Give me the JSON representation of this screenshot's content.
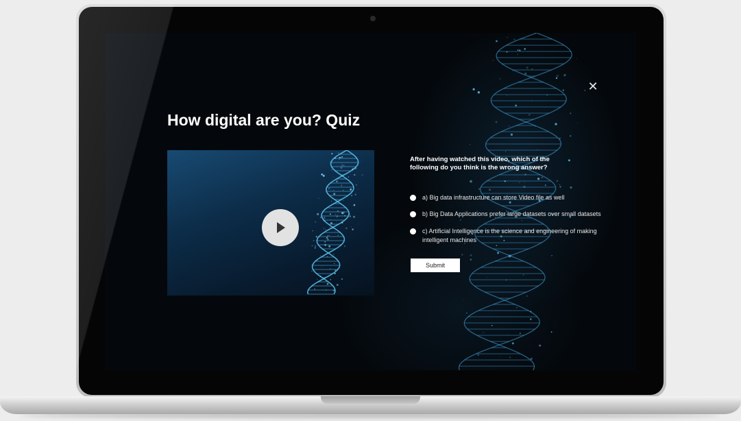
{
  "quiz": {
    "title": "How digital are you? Quiz",
    "close_icon": "close-icon",
    "play_icon": "play-icon",
    "question": "After having watched this video, which of the following do you think is the wrong answer?",
    "options": [
      {
        "label": "a) Big data infrastructure can store Video file as well"
      },
      {
        "label": "b) Big Data Applications prefer large datasets over small datasets"
      },
      {
        "label": "c) Artificial Intelligence is the science and engineering of making intelligent machines"
      }
    ],
    "submit_label": "Submit"
  },
  "colors": {
    "screen_bg": "#04080c",
    "accent_glow": "#4fb3e8",
    "button_bg": "#ffffff"
  }
}
